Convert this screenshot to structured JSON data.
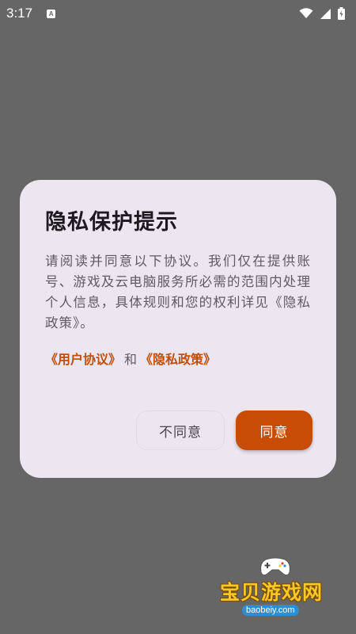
{
  "status_bar": {
    "time": "3:17",
    "notification_icon": "A",
    "icons": [
      "wifi-icon",
      "signal-icon",
      "battery-icon"
    ]
  },
  "dialog": {
    "title": "隐私保护提示",
    "body": "请阅读并同意以下协议。我们仅在提供账号、游戏及云电脑服务所必需的范围内处理个人信息，具体规则和您的权利详见《隐私政策》。",
    "user_agreement_link": "《用户协议》",
    "and_text": "和",
    "privacy_policy_link": "《隐私政策》",
    "disagree_label": "不同意",
    "agree_label": "同意"
  },
  "watermark": {
    "text": "宝贝游戏网",
    "url": "baobeiy.com"
  },
  "colors": {
    "backdrop": "#666666",
    "dialog_bg": "#ece6f0",
    "accent": "#c74d07",
    "link": "#c14e0b"
  }
}
